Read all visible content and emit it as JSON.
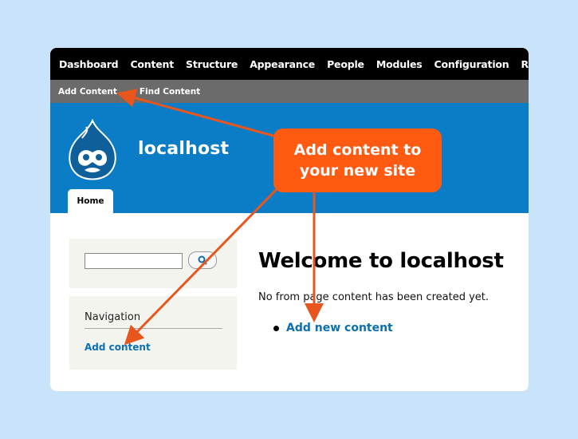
{
  "toolbar": {
    "items": [
      "Dashboard",
      "Content",
      "Structure",
      "Appearance",
      "People",
      "Modules",
      "Configuration",
      "Reports"
    ]
  },
  "shortcuts": {
    "items": [
      "Add Content",
      "Find Content"
    ]
  },
  "header": {
    "site_name": "localhost",
    "logo_icon": "drupal-drop-icon",
    "tab_home": "Home"
  },
  "sidebar": {
    "search_icon": "search-icon",
    "nav_title": "Navigation",
    "nav_link": "Add content"
  },
  "main": {
    "title": "Welcome to localhost",
    "message": "No from page content has been created yet.",
    "link": "Add new content"
  },
  "callout": {
    "line1": "Add content to",
    "line2": "your new site"
  },
  "colors": {
    "background": "#c9e3fb",
    "toolbar": "#000000",
    "shortcut_bar": "#6b6b6b",
    "header": "#0a7dc6",
    "link": "#0a6fb3",
    "callout": "#ff5a12",
    "arrow": "#e8561e"
  }
}
